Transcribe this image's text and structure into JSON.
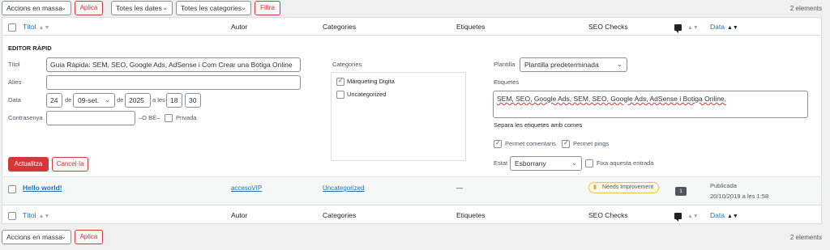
{
  "top_bar": {
    "bulk_actions": "Accions en massa",
    "apply": "Aplica",
    "all_dates": "Totes les dates",
    "all_categories": "Totes les categories",
    "filter": "Filtra",
    "count": "2 elements"
  },
  "columns": {
    "title": "Títol",
    "author": "Autor",
    "categories": "Categories",
    "tags": "Etiquetes",
    "seo": "SEO Checks",
    "date": "Data"
  },
  "quick_edit": {
    "heading": "EDITOR RÀPID",
    "title_label": "Títol",
    "title_value": "Guia Ràpida: SEM, SEO, Google Ads, AdSense i Com Crear una Botiga Online",
    "slug_label": "Àlies",
    "slug_value": "",
    "date_label": "Data",
    "day": "24",
    "de1": "de",
    "month": "09-set.",
    "de2": "de",
    "year": "2025",
    "at": "a les",
    "hour": "18",
    "minute": "30",
    "password_label": "Contrasenya",
    "or": "–O BÉ–",
    "private_label": "Privada",
    "categories_heading": "Categories",
    "category_items": [
      {
        "label": "Màrqueting Digita",
        "checked": true
      },
      {
        "label": "Uncategorized",
        "checked": false
      }
    ],
    "template_label": "Plantilla",
    "template_value": "Plantilla predeterminada",
    "tags_label": "Etiquetes",
    "tags_value": "SEM, SEO, Google Ads, SEM, SEO, Google Ads, AdSense i Botiga Online,",
    "tags_hint": "Separa les etiquetes amb comes",
    "allow_comments": "Permet comentaris",
    "allow_pings": "Permet pings",
    "status_label": "Estat",
    "status_value": "Esborrany",
    "sticky_label": "Fixa aquesta entrada",
    "update_button": "Actualitza",
    "cancel_button": "Cancel·la"
  },
  "row": {
    "title": "Hello world!",
    "author": "accesoVIP",
    "category": "Uncategorized",
    "tags": "—",
    "seo_badge": "Needs Improvement",
    "comments": "1",
    "status": "Publicada",
    "datetime": "20/10/2019 a les 1:58"
  },
  "bottom_bar": {
    "bulk_actions": "Accions en massa",
    "apply": "Aplica",
    "count": "2 elements"
  }
}
